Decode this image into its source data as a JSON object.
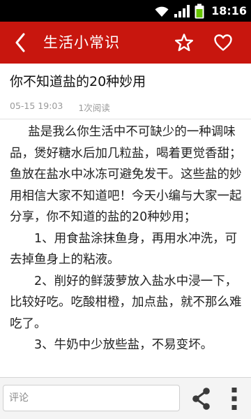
{
  "status_bar": {
    "time": "18:16",
    "icons": [
      "wifi-icon",
      "signal-icon",
      "battery-icon"
    ]
  },
  "header": {
    "title": "生活小常识",
    "background_color": "#c8160e",
    "back_icon": "back-icon",
    "actions": [
      "star-icon",
      "heart-icon"
    ]
  },
  "article": {
    "title": "你不知道盐的20种妙用",
    "date": "05-15 19:03",
    "reads": "1次阅读",
    "paragraphs": [
      "盐是我么你生活中不可缺少的一种调味品，煲好糖水后加几粒盐，喝着更觉香甜；　鱼放在盐水中冰冻可避免发干。这些盐的妙用相信大家不知道吧！今天小编与大家一起分享，你不知道的盐的20种妙用；",
      "1、用食盐涂抹鱼身，再用水冲洗，可去掉鱼身上的粘液。",
      "2、削好的鲜菠萝放入盐水中浸一下，比较好吃。吃酸柑橙，加点盐，就不那么难吃了。",
      "3、牛奶中少放些盐，不易变坏。"
    ]
  },
  "bottom_bar": {
    "comment_placeholder": "评论",
    "share_icon": "share-icon",
    "more_icon": "more-icon"
  }
}
